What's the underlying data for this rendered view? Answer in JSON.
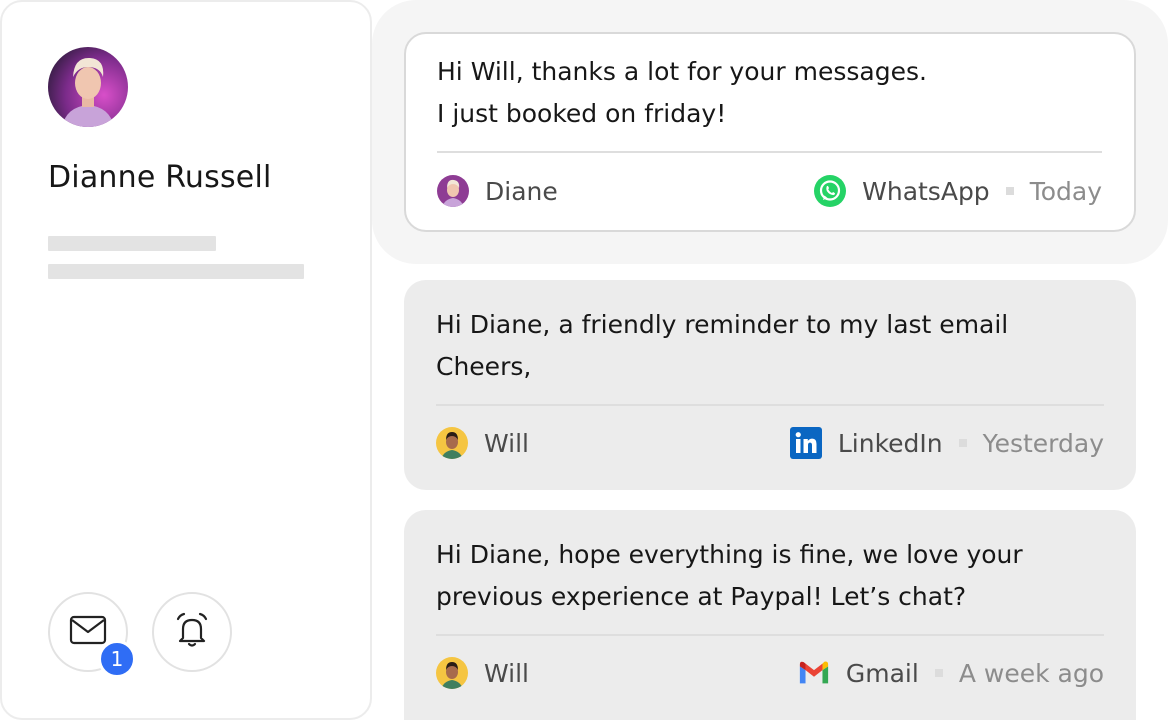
{
  "profile": {
    "name": "Dianne Russell",
    "mail_badge_count": "1",
    "icons": {
      "mail": "mail-icon",
      "bell": "bell-icon",
      "avatar": "profile-avatar"
    }
  },
  "messages": [
    {
      "line1": "Hi Will, thanks a lot for your messages.",
      "line2": "I just booked on friday!",
      "sender": "Diane",
      "channel": "WhatsApp",
      "channel_icon": "whatsapp-icon",
      "time": "Today",
      "highlighted": true
    },
    {
      "line1": "Hi Diane, a friendly reminder to my last email",
      "line2": "Cheers,",
      "sender": "Will",
      "channel": "LinkedIn",
      "channel_icon": "linkedin-icon",
      "time": "Yesterday",
      "highlighted": false
    },
    {
      "line1": "Hi Diane, hope everything is fine, we love your",
      "line2": "previous experience at Paypal! Let’s chat?",
      "sender": "Will",
      "channel": "Gmail",
      "channel_icon": "gmail-icon",
      "time": "A week ago",
      "highlighted": false
    }
  ],
  "colors": {
    "badge": "#2f6df5",
    "whatsapp": "#25d366",
    "linkedin": "#0a66c2",
    "card_bg": "#ececec",
    "highlight_bg": "#f5f5f5"
  }
}
